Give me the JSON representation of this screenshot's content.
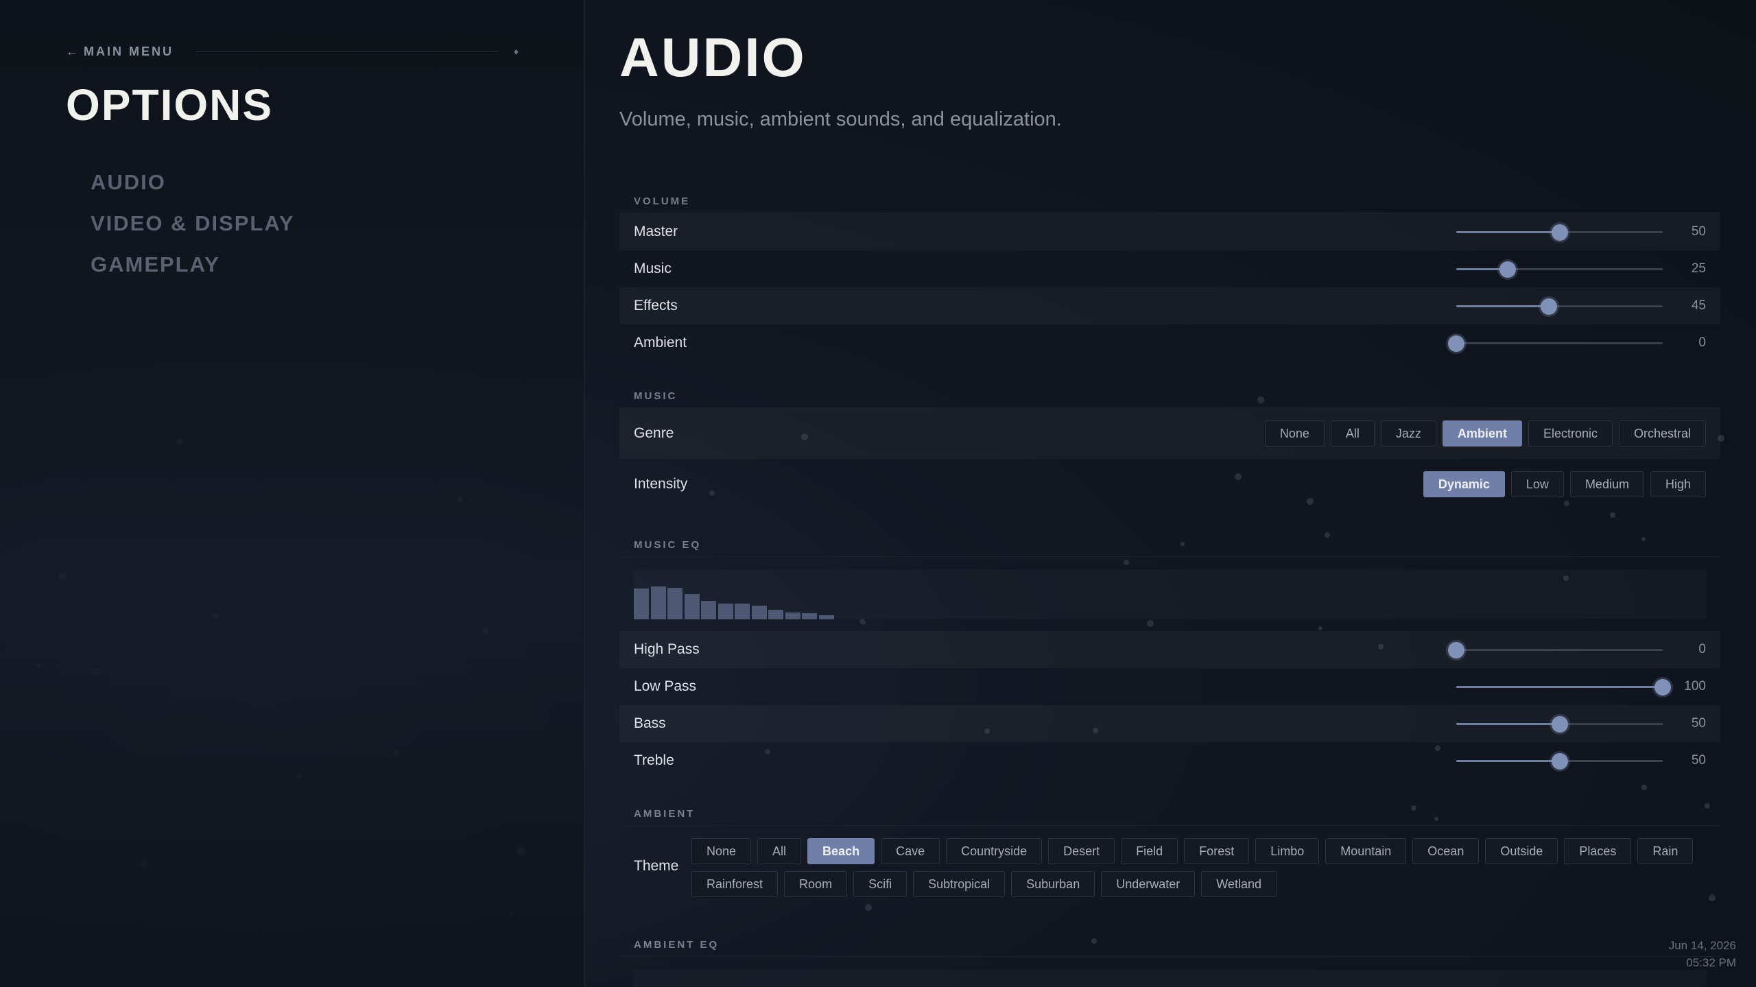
{
  "sidebar": {
    "back_label": "MAIN MENU",
    "back_arrow": "←",
    "diamond": "♦",
    "title": "OPTIONS",
    "nav": [
      "AUDIO",
      "VIDEO & DISPLAY",
      "GAMEPLAY"
    ]
  },
  "page": {
    "title": "AUDIO",
    "subtitle": "Volume, music, ambient sounds, and equalization."
  },
  "volume": {
    "section_label": "VOLUME",
    "master": {
      "label": "Master",
      "value": "50"
    },
    "music": {
      "label": "Music",
      "value": "25"
    },
    "effects": {
      "label": "Effects",
      "value": "45"
    },
    "ambient": {
      "label": "Ambient",
      "value": "0"
    }
  },
  "music": {
    "section_label": "MUSIC",
    "genre_label": "Genre",
    "genre_options": [
      "None",
      "All",
      "Jazz",
      "Ambient",
      "Electronic",
      "Orchestral"
    ],
    "genre_selected": "Ambient",
    "intensity_label": "Intensity",
    "intensity_options": [
      "Dynamic",
      "Low",
      "Medium",
      "High"
    ],
    "intensity_selected": "Dynamic"
  },
  "music_eq": {
    "section_label": "MUSIC EQ",
    "spectrum_levels": [
      0.62,
      0.66,
      0.64,
      0.52,
      0.38,
      0.32,
      0.32,
      0.28,
      0.2,
      0.14,
      0.12,
      0.08
    ],
    "high_pass": {
      "label": "High Pass",
      "value": "0"
    },
    "low_pass": {
      "label": "Low Pass",
      "value": "100"
    },
    "bass": {
      "label": "Bass",
      "value": "50"
    },
    "treble": {
      "label": "Treble",
      "value": "50"
    }
  },
  "ambient": {
    "section_label": "AMBIENT",
    "theme_label": "Theme",
    "themes": [
      "None",
      "All",
      "Beach",
      "Cave",
      "Countryside",
      "Desert",
      "Field",
      "Forest",
      "Limbo",
      "Mountain",
      "Ocean",
      "Outside",
      "Places",
      "Rain",
      "Rainforest",
      "Room",
      "Scifi",
      "Subtropical",
      "Suburban",
      "Underwater",
      "Wetland"
    ],
    "theme_selected": "Beach"
  },
  "ambient_eq": {
    "section_label": "AMBIENT EQ"
  },
  "clock": {
    "date": "Jun 14, 2026",
    "time": "05:32 PM"
  },
  "colors": {
    "accent": "#6f7fa7",
    "thumb": "#8091b8",
    "background": "#0e1219"
  }
}
